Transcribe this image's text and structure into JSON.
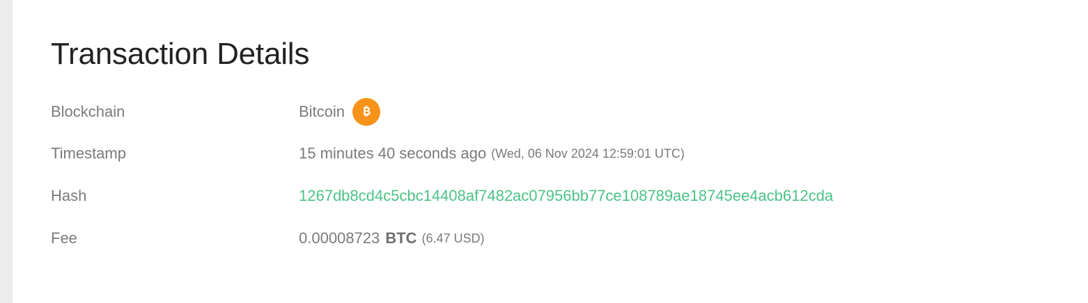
{
  "page": {
    "title": "Transaction Details"
  },
  "details": {
    "blockchain": {
      "label": "Blockchain",
      "value": "Bitcoin",
      "icon": "bitcoin-icon",
      "icon_color": "#f7931a"
    },
    "timestamp": {
      "label": "Timestamp",
      "relative": "15 minutes 40 seconds ago",
      "absolute": "(Wed, 06 Nov 2024 12:59:01 UTC)"
    },
    "hash": {
      "label": "Hash",
      "value": "1267db8cd4c5cbc14408af7482ac07956bb77ce108789ae18745ee4acb612cda",
      "color": "#4cc285"
    },
    "fee": {
      "label": "Fee",
      "amount": "0.00008723",
      "unit": "BTC",
      "usd": "(6.47 USD)"
    }
  }
}
